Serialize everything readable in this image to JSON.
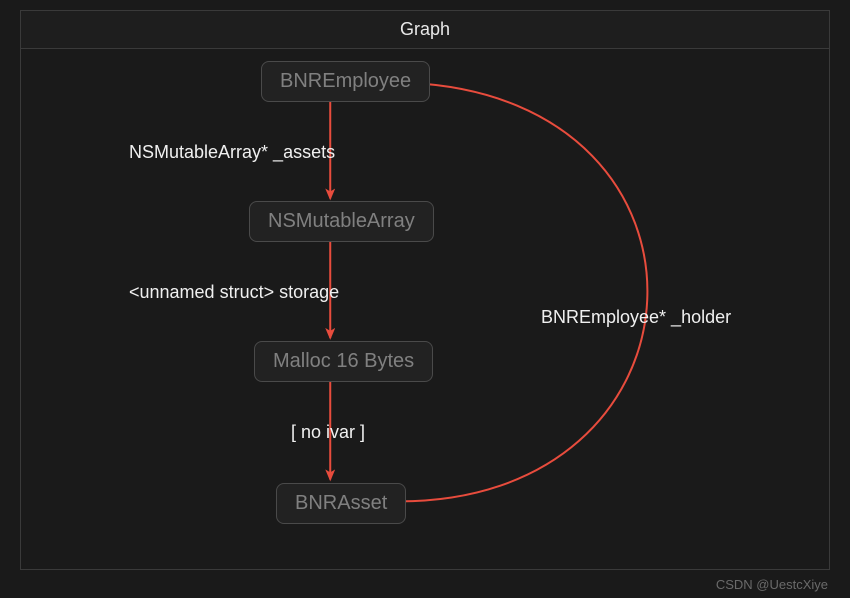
{
  "header": {
    "title": "Graph"
  },
  "nodes": {
    "employee": {
      "label": "BNREmployee"
    },
    "array": {
      "label": "NSMutableArray"
    },
    "malloc": {
      "label": "Malloc 16 Bytes"
    },
    "asset": {
      "label": "BNRAsset"
    }
  },
  "edges": {
    "assets": {
      "label": "NSMutableArray* _assets"
    },
    "storage": {
      "label": "<unnamed struct> storage"
    },
    "noivar": {
      "label": "[ no ivar ]"
    },
    "holder": {
      "label": "BNREmployee* _holder"
    }
  },
  "colors": {
    "arrow": "#e84c3d",
    "arrow_fill": "#c0392b"
  },
  "watermark": "CSDN @UestcXiye"
}
